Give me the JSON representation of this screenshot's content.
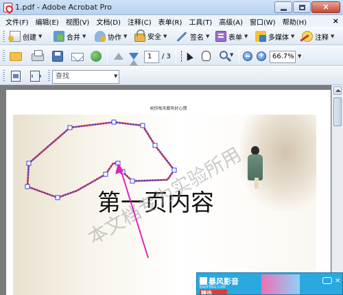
{
  "window": {
    "title": "1.pdf - Adobe Acrobat Pro"
  },
  "menu": {
    "items": [
      "文件(F)",
      "编辑(E)",
      "视图(V)",
      "文档(D)",
      "注释(C)",
      "表单(R)",
      "工具(T)",
      "高级(A)",
      "窗口(W)",
      "帮助(H)"
    ],
    "close_glyph": "×"
  },
  "toolbar_tasks": {
    "create": "创建",
    "combine": "合并",
    "collaborate": "协作",
    "secure": "安全",
    "sign": "签名",
    "forms": "表单",
    "multimedia": "多媒体",
    "comment": "注释"
  },
  "toolbar_nav": {
    "current_page": "1",
    "total_pages": "/ 3",
    "zoom": "66.7%"
  },
  "toolbar_find": {
    "find_placeholder": "查找"
  },
  "document": {
    "header_text": "祝你每天都有好心情",
    "slide_title": "第一页内容",
    "watermark": "本文档专为实验所用",
    "annotation_cloud_color": "#e23c3c",
    "annotation_line_color": "#3344ee",
    "arrow_color": "#e020c0"
  },
  "popup_ad": {
    "logo": "暴风影音",
    "subtitle": "BAOFENG.COM",
    "tag": "精选"
  },
  "colors": {
    "titlebar": "#c4d9f1",
    "toolbar": "#e6edf6",
    "viewport_bg": "#7b7b7b"
  }
}
